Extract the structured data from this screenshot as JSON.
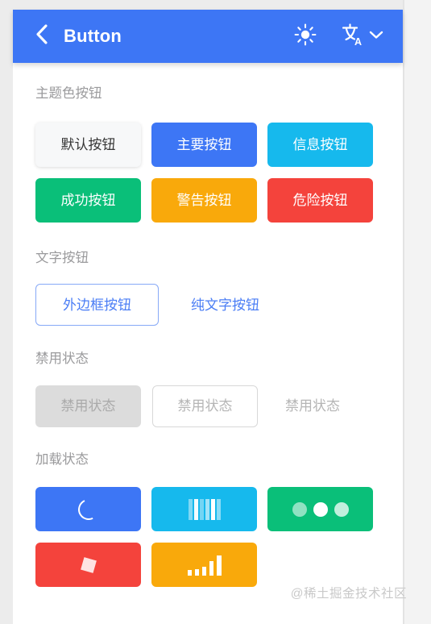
{
  "header": {
    "title": "Button",
    "back_icon": "chevron-left-icon",
    "brightness_icon": "sun-icon",
    "translate_icon": "translate-icon",
    "dropdown_icon": "chevron-down-icon"
  },
  "sections": [
    {
      "title": "主题色按钮",
      "buttons": [
        {
          "label": "默认按钮",
          "variant": "default",
          "color": "#f7f8f9"
        },
        {
          "label": "主要按钮",
          "variant": "primary",
          "color": "#3d76f5"
        },
        {
          "label": "信息按钮",
          "variant": "info",
          "color": "#16b9ed"
        },
        {
          "label": "成功按钮",
          "variant": "success",
          "color": "#0abf79"
        },
        {
          "label": "警告按钮",
          "variant": "warning",
          "color": "#f9a90b"
        },
        {
          "label": "危险按钮",
          "variant": "danger",
          "color": "#f4433c"
        }
      ]
    },
    {
      "title": "文字按钮",
      "buttons": [
        {
          "label": "外边框按钮",
          "variant": "outline",
          "color": "#4a7df5"
        },
        {
          "label": "纯文字按钮",
          "variant": "plain",
          "color": "#4a7df5"
        }
      ]
    },
    {
      "title": "禁用状态",
      "buttons": [
        {
          "label": "禁用状态",
          "variant": "disabled-fill",
          "color": "#dcdcdc"
        },
        {
          "label": "禁用状态",
          "variant": "disabled-outline",
          "color": "#ffffff"
        },
        {
          "label": "禁用状态",
          "variant": "disabled-plain",
          "color": "#b5b5b5"
        }
      ]
    },
    {
      "title": "加载状态",
      "buttons": [
        {
          "label": "",
          "variant": "primary",
          "color": "#3d76f5",
          "spinner": "arc-spinner-icon"
        },
        {
          "label": "",
          "variant": "info",
          "color": "#16b9ed",
          "spinner": "bars-spinner-icon"
        },
        {
          "label": "",
          "variant": "success",
          "color": "#0abf79",
          "spinner": "dots-spinner-icon"
        },
        {
          "label": "",
          "variant": "danger",
          "color": "#f4433c",
          "spinner": "square-spinner-icon"
        },
        {
          "label": "",
          "variant": "warning",
          "color": "#f9a90b",
          "spinner": "steps-spinner-icon"
        }
      ]
    }
  ],
  "watermark": {
    "text": "@稀土掘金技术社区"
  },
  "theme": {
    "accent": "#3d76f5",
    "page_background": "#ececec",
    "card_background": "#ffffff",
    "section_title_color": "#9a9a9c"
  }
}
